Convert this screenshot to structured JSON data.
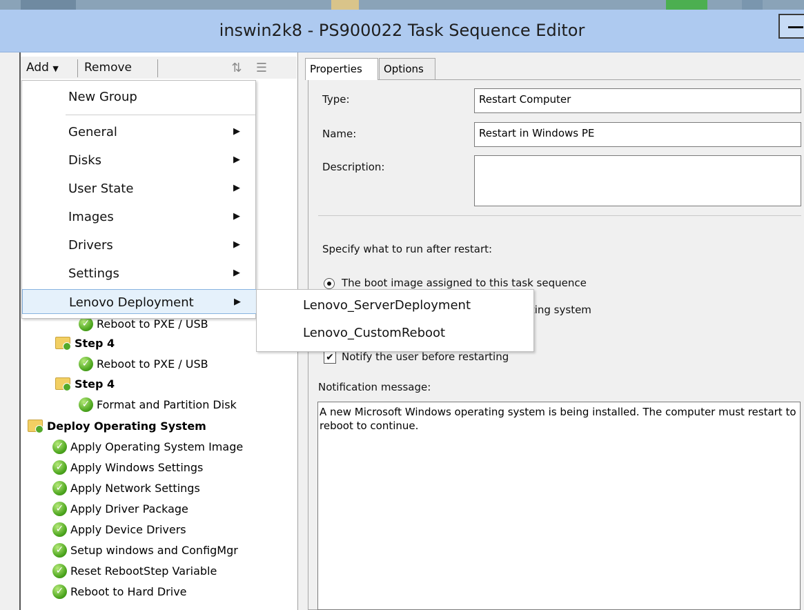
{
  "window": {
    "title": "inswin2k8 - PS900022 Task Sequence Editor"
  },
  "colors": {
    "titlebar": "#aecaf0",
    "check_green": "#4ca51e",
    "menu_hover": "#e5f1fb"
  },
  "toolbar": {
    "add_label": "Add",
    "add_dropdown_icon": "chevron-down-icon",
    "remove_label": "Remove",
    "icons": [
      "move-up-icon",
      "move-down-icon"
    ]
  },
  "add_menu": {
    "items": [
      {
        "label": "New Group",
        "submenu": false
      },
      {
        "label": "General",
        "submenu": true
      },
      {
        "label": "Disks",
        "submenu": true
      },
      {
        "label": "User State",
        "submenu": true
      },
      {
        "label": "Images",
        "submenu": true
      },
      {
        "label": "Drivers",
        "submenu": true
      },
      {
        "label": "Settings",
        "submenu": true
      },
      {
        "label": "Lenovo Deployment",
        "submenu": true,
        "highlighted": true
      }
    ],
    "submenu_arrow": "▶"
  },
  "lenovo_submenu": {
    "items": [
      "Lenovo_ServerDeployment",
      "Lenovo_CustomReboot"
    ]
  },
  "tree": {
    "nodes": [
      {
        "label": "Reboot to PXE / USB",
        "type": "step"
      },
      {
        "label": "Step 4",
        "type": "group"
      },
      {
        "label": "Reboot to PXE / USB",
        "type": "step"
      },
      {
        "label": "Step 4",
        "type": "group"
      },
      {
        "label": "Format and Partition Disk",
        "type": "step"
      },
      {
        "label": "Deploy Operating System",
        "type": "group"
      },
      {
        "label": "Apply Operating System Image",
        "type": "step"
      },
      {
        "label": "Apply Windows Settings",
        "type": "step"
      },
      {
        "label": "Apply Network Settings",
        "type": "step"
      },
      {
        "label": "Apply Driver Package",
        "type": "step"
      },
      {
        "label": "Apply Device Drivers",
        "type": "step"
      },
      {
        "label": "Setup windows and ConfigMgr",
        "type": "step"
      },
      {
        "label": "Reset RebootStep Variable",
        "type": "step"
      },
      {
        "label": "Reboot to Hard Drive",
        "type": "step"
      }
    ]
  },
  "tabs": [
    {
      "label": "Properties",
      "active": true
    },
    {
      "label": "Options",
      "active": false
    }
  ],
  "properties": {
    "type_label": "Type:",
    "type_value": "Restart Computer",
    "name_label": "Name:",
    "name_value": "Restart in Windows PE",
    "description_label": "Description:",
    "description_value": "",
    "run_after_label": "Specify what to run after restart:",
    "radio_1_label": "The boot image assigned to this task sequence",
    "radio_1_selected": true,
    "radio_2_label": "The currently installed default operating system",
    "radio_2_selected": false,
    "notify_checkbox_label": "Notify the user before restarting",
    "notify_checked": true,
    "notification_label": "Notification message:",
    "notification_line1": "A new Microsoft Windows operating system is being installed.  The computer must restart to",
    "notification_line2": "reboot to continue."
  }
}
